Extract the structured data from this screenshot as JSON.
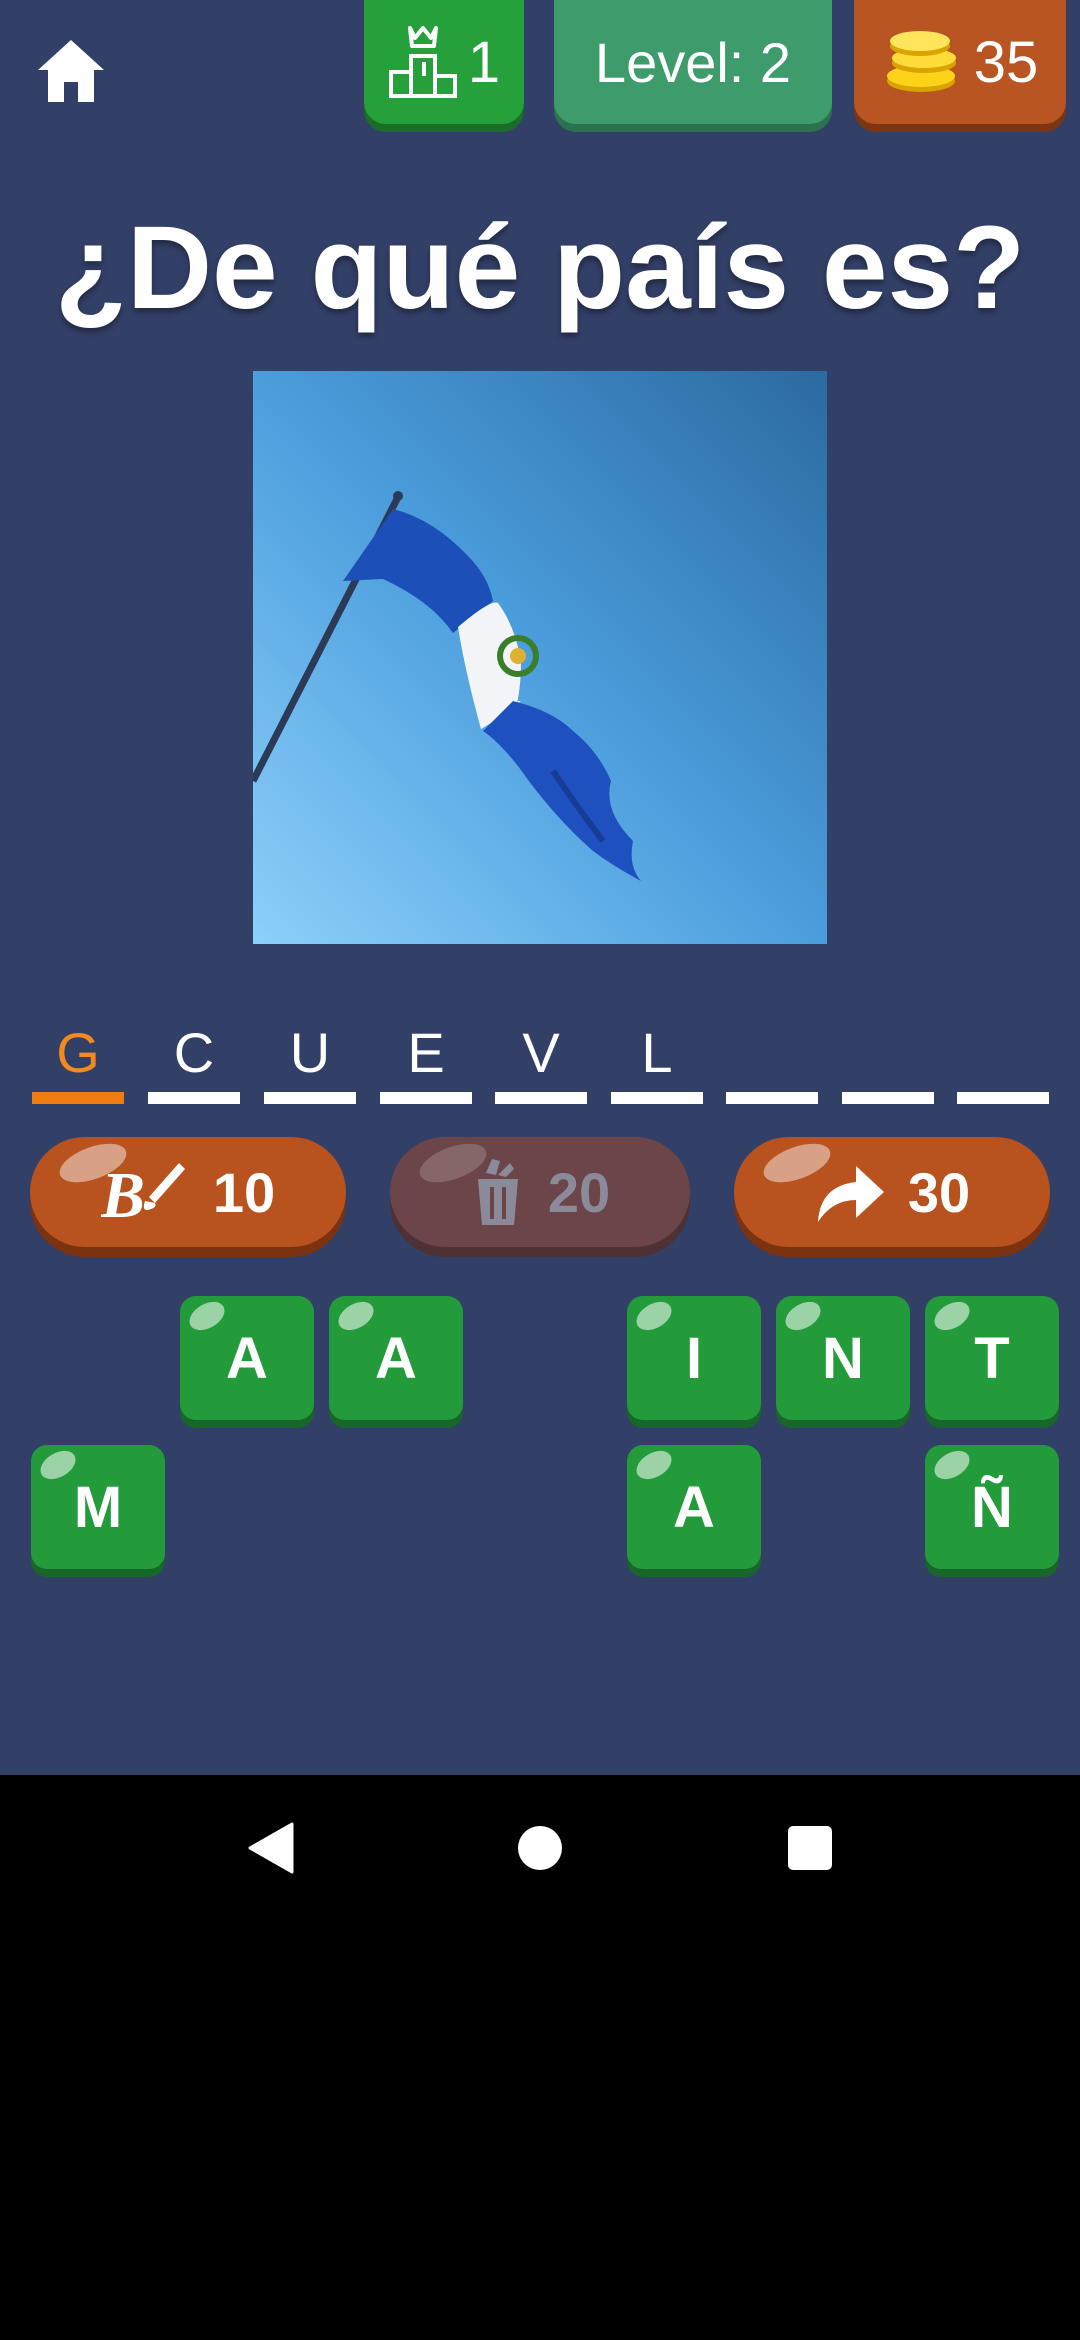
{
  "header": {
    "rank_value": "1",
    "level_label": "Level: 2",
    "coins_value": "35"
  },
  "question": "¿De qué país es?",
  "answer_slots": [
    {
      "char": "G",
      "active": true
    },
    {
      "char": "C"
    },
    {
      "char": "U"
    },
    {
      "char": "E"
    },
    {
      "char": "V"
    },
    {
      "char": "L"
    },
    {
      "char": ""
    },
    {
      "char": ""
    },
    {
      "char": ""
    }
  ],
  "powerups": {
    "reveal_cost": "10",
    "remove_cost": "20",
    "skip_cost": "30"
  },
  "tiles": {
    "row1": [
      "A",
      "A",
      "I",
      "N",
      "T"
    ],
    "row2": [
      "M",
      "A",
      "Ñ"
    ]
  },
  "colors": {
    "background": "#323f67",
    "tile_green": "#239b3a",
    "powerup_orange": "#b8521f",
    "active_slot": "#f07d10"
  },
  "icons": [
    "home-icon",
    "podium-icon",
    "coins-icon",
    "brush-icon",
    "trash-icon",
    "skip-arrow-icon",
    "nav-back-icon",
    "nav-home-icon",
    "nav-recents-icon"
  ]
}
